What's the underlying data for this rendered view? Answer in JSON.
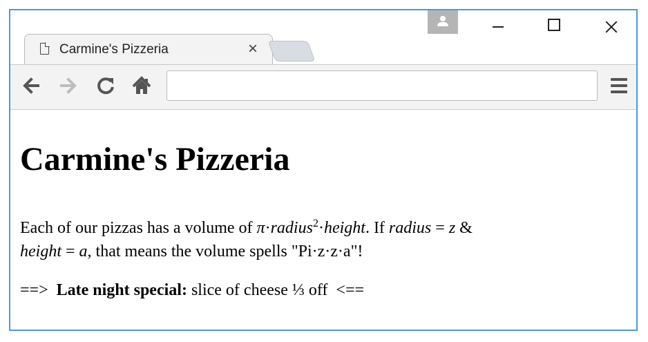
{
  "browser": {
    "tab_title": "Carmine's Pizzeria",
    "tab_close": "×",
    "address": "",
    "icons": {
      "profile": "user-avatar-icon",
      "minimize": "minimize-icon",
      "maximize": "maximize-icon",
      "close": "close-icon",
      "back": "arrow-left-icon",
      "forward": "arrow-right-icon",
      "reload": "reload-icon",
      "home": "home-icon",
      "menu": "hamburger-menu-icon",
      "page": "page-icon"
    },
    "colors": {
      "frame_border": "#4a9bd6",
      "toolbar": "#f3f3f3",
      "profile": "#b5b5b5"
    }
  },
  "page": {
    "heading": "Carmine's Pizzeria",
    "paragraph": {
      "p1": "Each of our pizzas has a volume of ",
      "pi": "π",
      "dot1": "·",
      "radius1": "radius",
      "exp": "2",
      "dot2": "·",
      "height1": "height",
      "p2": ". If ",
      "radius2": "radius",
      "p3": " = ",
      "z": "z",
      "p4": " & ",
      "height2": "height",
      "p5": " = ",
      "a": "a",
      "p6": ", that means the volume spells \"Pi·z·z·a\"!"
    },
    "special": {
      "left_arrow": "==>",
      "label": "Late night special:",
      "text": " slice of cheese ⅓ off",
      "right_arrow": "<=="
    }
  }
}
